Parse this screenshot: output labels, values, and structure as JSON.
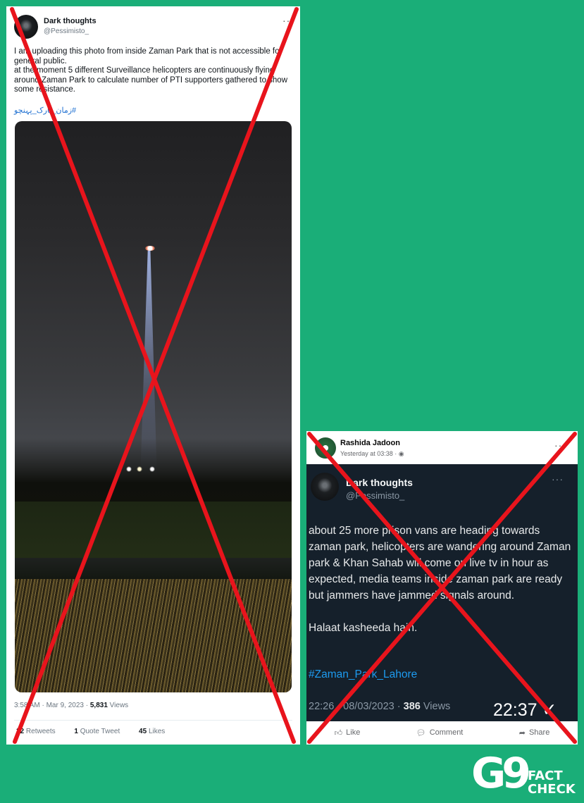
{
  "tweet": {
    "display_name": "Dark thoughts",
    "handle": "@Pessimisto_",
    "more": "···",
    "body_line1": "I am uploading this photo from inside Zaman Park that is not accessible for general public.",
    "body_line2": "at the moment 5 different Surveillance helicopters are continuously flying around Zaman Park to calculate number of PTI supporters gathered to show some resistance.",
    "hashtag": "#زمان_پارک_پہنچو",
    "time": "3:58 AM",
    "date": "Mar 9, 2023",
    "views_count": "5,831",
    "views_label": "Views",
    "retweets_count": "22",
    "retweets_label": "Retweets",
    "quotes_count": "1",
    "quotes_label": "Quote Tweet",
    "likes_count": "45",
    "likes_label": "Likes"
  },
  "facebook_post": {
    "author": "Rashida Jadoon",
    "timestamp": "Yesterday at 03:38 · ",
    "more": "···",
    "screenshot": {
      "display_name": "Dark thoughts",
      "handle": "@Pessimisto_",
      "more": "···",
      "body": "about 25 more prison vans are heading towards zaman park, helicopters are wandering around Zaman park & Khan Sahab will come on live tv in hour as expected, media teams inside zaman park are ready but jammers have jammed signals around.",
      "body2": "Halaat kasheeda hain.",
      "hashtag": "#Zaman_Park_Lahore",
      "time": "22:26 · 08/03/2023 · ",
      "views_count": "386",
      "views_label": "Views",
      "clock": "22:37 ✓"
    },
    "actions": {
      "like": "Like",
      "comment": "Comment",
      "share": "Share"
    }
  },
  "logo": {
    "mark": "G9",
    "line1": "FACT",
    "line2": "CHECK"
  },
  "colors": {
    "background": "#1aae78",
    "cross": "#e8141c"
  }
}
